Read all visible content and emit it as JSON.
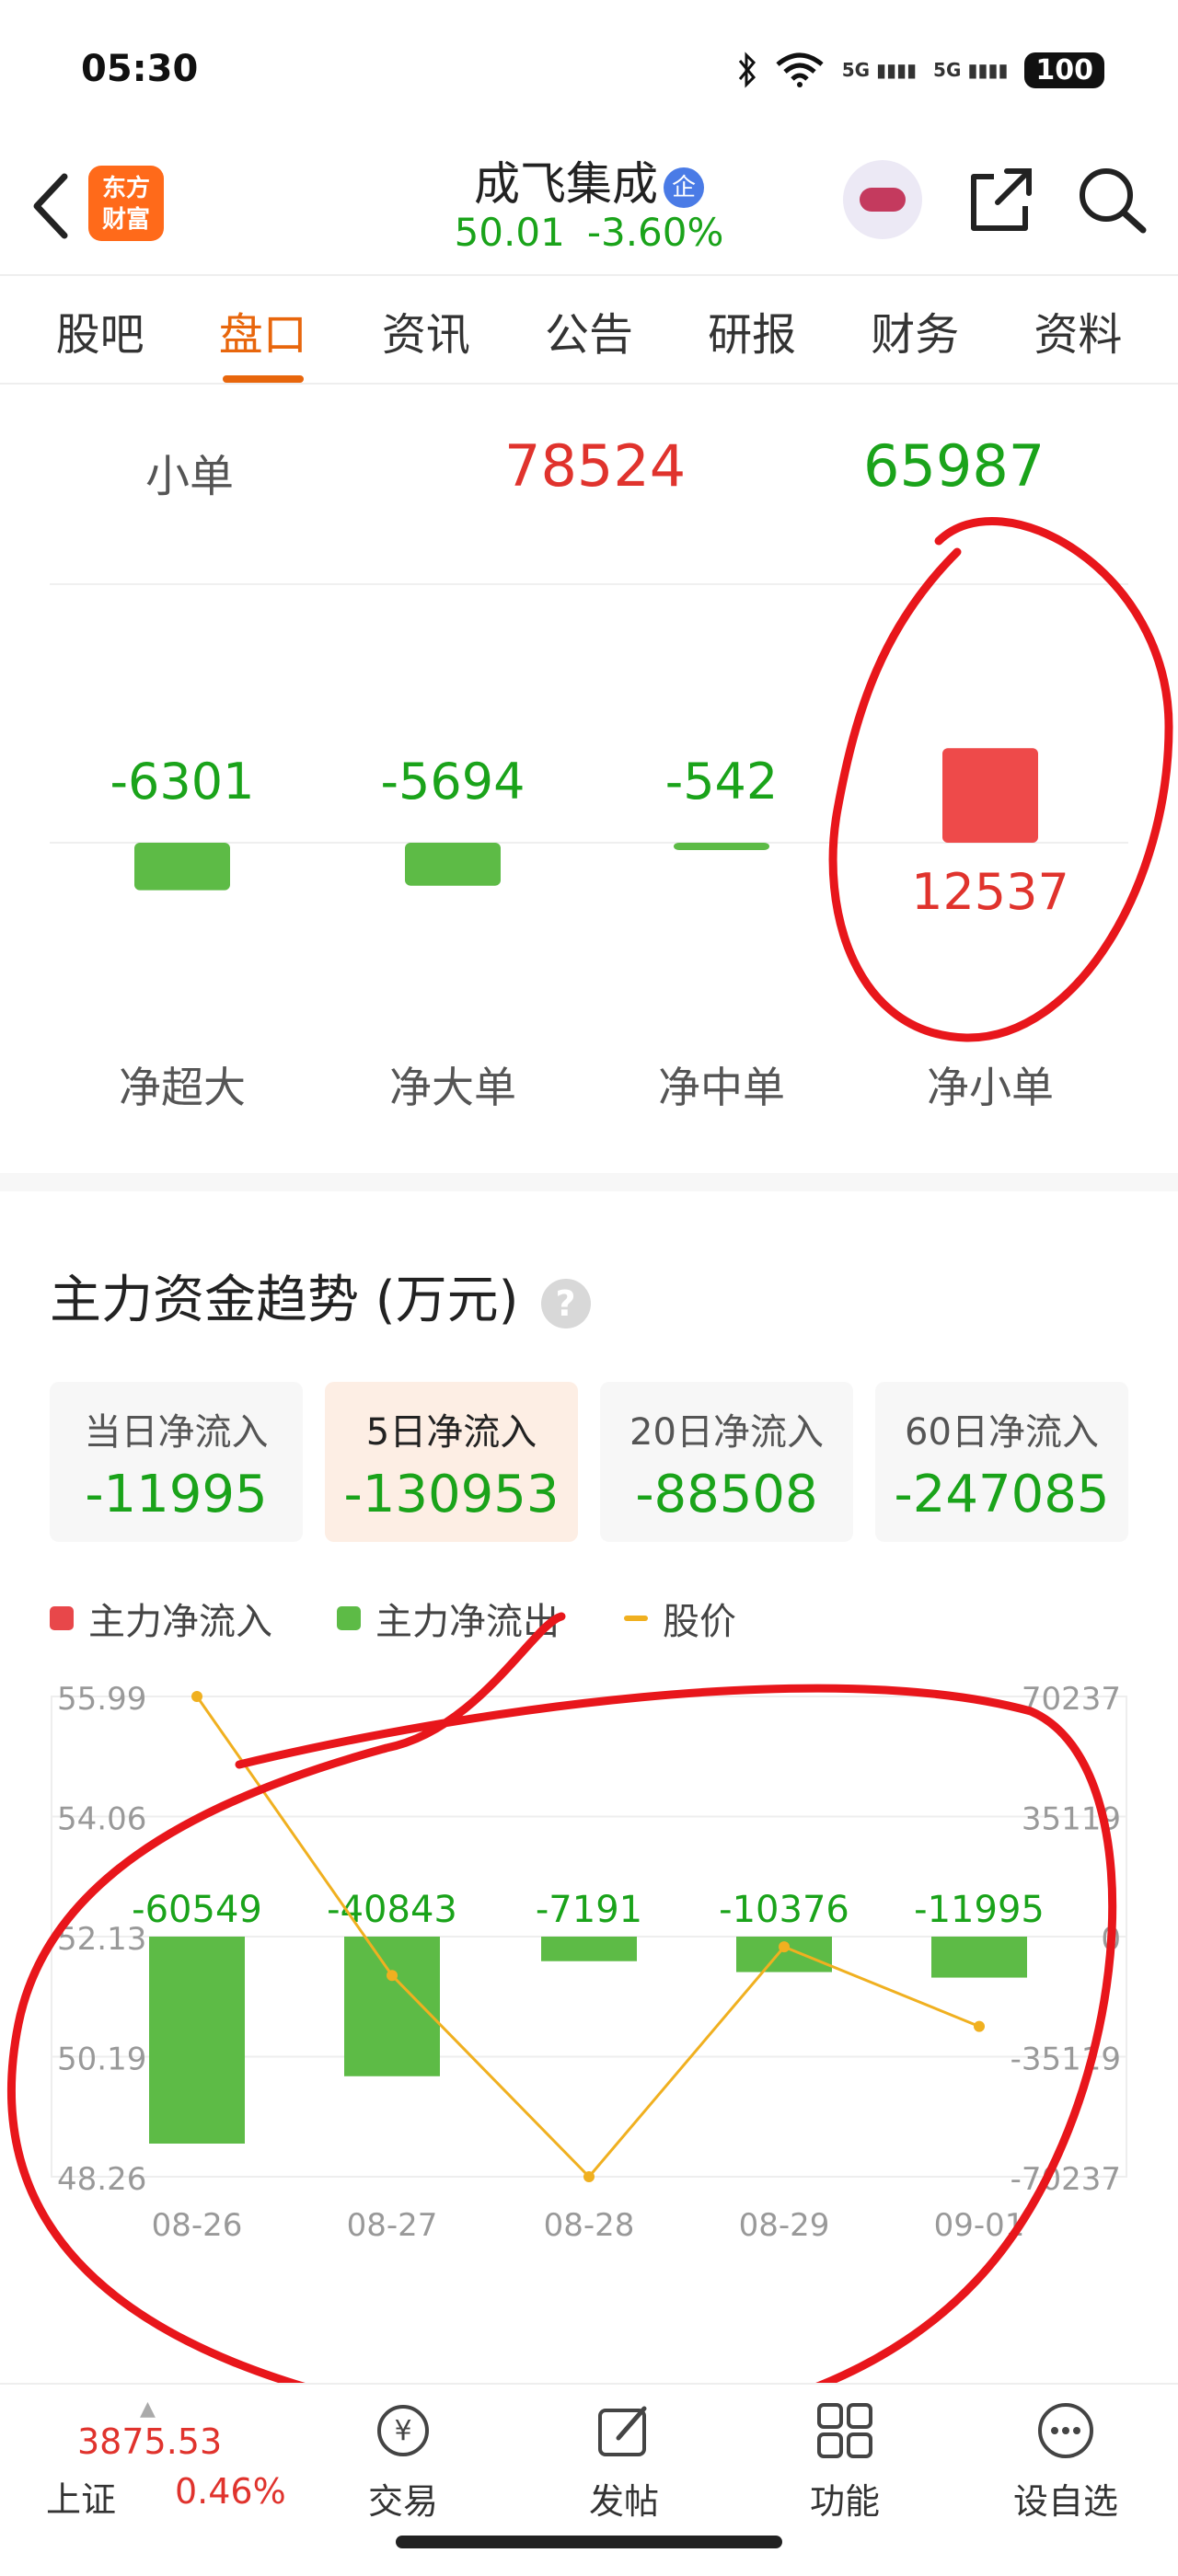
{
  "status_bar": {
    "time": "05:30",
    "network1": "5G",
    "network2": "5G",
    "battery": "100"
  },
  "header": {
    "logo_line1": "东方",
    "logo_line2": "财富",
    "stock_name": "成飞集成",
    "badge": "企",
    "price": "50.01",
    "change": "-3.60%"
  },
  "tabs": [
    {
      "label": "股吧"
    },
    {
      "label": "盘口"
    },
    {
      "label": "资讯"
    },
    {
      "label": "公告"
    },
    {
      "label": "研报"
    },
    {
      "label": "财务"
    },
    {
      "label": "资料"
    }
  ],
  "active_tab": "盘口",
  "order_row": {
    "label": "小单",
    "buy": "78524",
    "sell": "65987"
  },
  "net_flow": {
    "categories": [
      "净超大",
      "净大单",
      "净中单",
      "净小单"
    ],
    "values": [
      -6301,
      -5694,
      -542,
      12537
    ],
    "labels": [
      "-6301",
      "-5694",
      "-542",
      "12537"
    ]
  },
  "trend": {
    "title": "主力资金趋势 (万元)",
    "help": "?",
    "periods": [
      {
        "label": "当日净流入",
        "value": "-11995"
      },
      {
        "label": "5日净流入",
        "value": "-130953"
      },
      {
        "label": "20日净流入",
        "value": "-88508"
      },
      {
        "label": "60日净流入",
        "value": "-247085"
      }
    ],
    "legend": {
      "inflow": "主力净流入",
      "outflow": "主力净流出",
      "price": "股价"
    }
  },
  "chart_data": {
    "type": "bar",
    "categories": [
      "08-26",
      "08-27",
      "08-28",
      "08-29",
      "09-01"
    ],
    "series": [
      {
        "name": "主力净流出",
        "values": [
          -60549,
          -40843,
          -7191,
          -10376,
          -11995
        ]
      },
      {
        "name": "股价",
        "values": [
          55.99,
          51.5,
          48.26,
          51.96,
          50.68
        ]
      }
    ],
    "bar_labels": [
      "-60549",
      "-40843",
      "-7191",
      "-10376",
      "-11995"
    ],
    "left_ticks": [
      "55.99",
      "54.06",
      "52.13",
      "50.19",
      "48.26"
    ],
    "right_ticks": [
      "70237",
      "35119",
      "0",
      "-35119",
      "-70237"
    ],
    "ylim_price": [
      48.26,
      55.99
    ],
    "ylim_flow": [
      -70237,
      70237
    ],
    "colors": {
      "inflow": "#e8474a",
      "outflow": "#5dbb46",
      "price": "#f0b020"
    }
  },
  "bottom_bar": {
    "index_value": "3875.53",
    "index_name": "上证",
    "index_pct": "0.46%",
    "nav": [
      {
        "label": "交易",
        "icon": "trade-icon"
      },
      {
        "label": "发帖",
        "icon": "post-icon"
      },
      {
        "label": "功能",
        "icon": "apps-icon"
      },
      {
        "label": "设自选",
        "icon": "more-icon"
      }
    ]
  },
  "colors": {
    "up": "#e0332d",
    "down": "#1aa31a",
    "accent": "#e8660c"
  }
}
